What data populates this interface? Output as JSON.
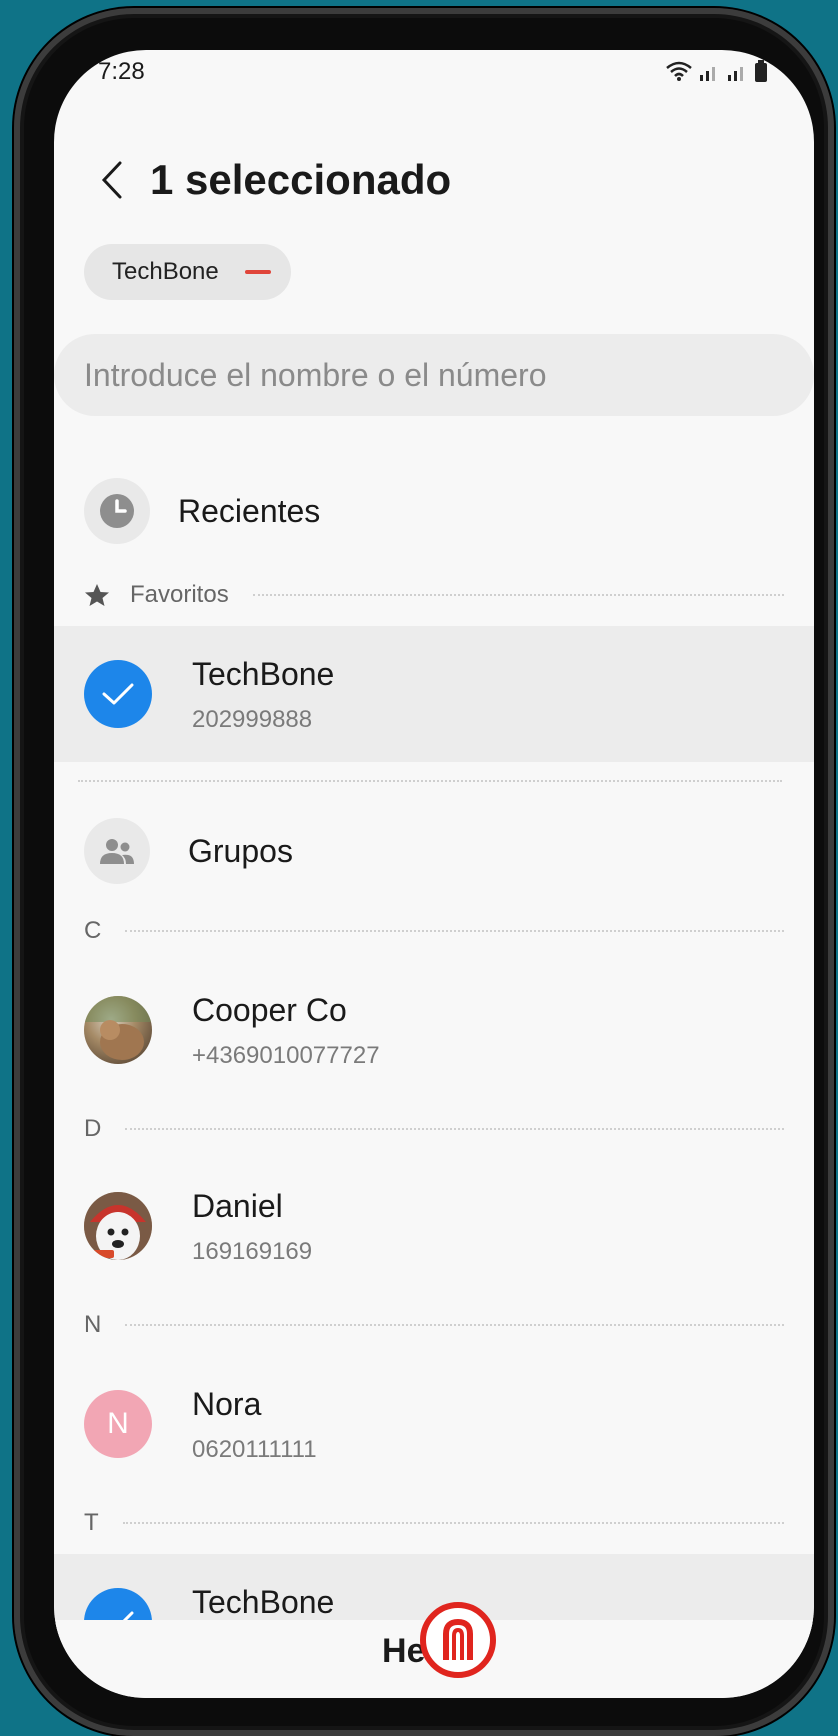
{
  "status_bar": {
    "time": "7:28"
  },
  "header": {
    "title": "1 seleccionado"
  },
  "chip": {
    "label": "TechBone"
  },
  "search": {
    "placeholder": "Introduce el nombre o el número"
  },
  "recent": {
    "label": "Recientes"
  },
  "favorites": {
    "label": "Favoritos",
    "contacts": [
      {
        "name": "TechBone",
        "number": "202999888",
        "selected": true
      }
    ]
  },
  "groups": {
    "label": "Grupos"
  },
  "sections": [
    {
      "letter": "C",
      "contacts": [
        {
          "name": "Cooper Co",
          "number": "+4369010077727"
        }
      ]
    },
    {
      "letter": "D",
      "contacts": [
        {
          "name": "Daniel",
          "number": "169169169"
        }
      ]
    },
    {
      "letter": "N",
      "contacts": [
        {
          "name": "Nora",
          "number": "0620111111",
          "initial": "N"
        }
      ]
    },
    {
      "letter": "T",
      "contacts": [
        {
          "name": "TechBone",
          "selected": true
        }
      ]
    }
  ],
  "footer": {
    "done_label": "Hecho"
  },
  "colors": {
    "accent_blue": "#1d86ea",
    "remove_red": "#e0453a",
    "nora_avatar": "#f2a6b4",
    "background": "#0f7387"
  }
}
